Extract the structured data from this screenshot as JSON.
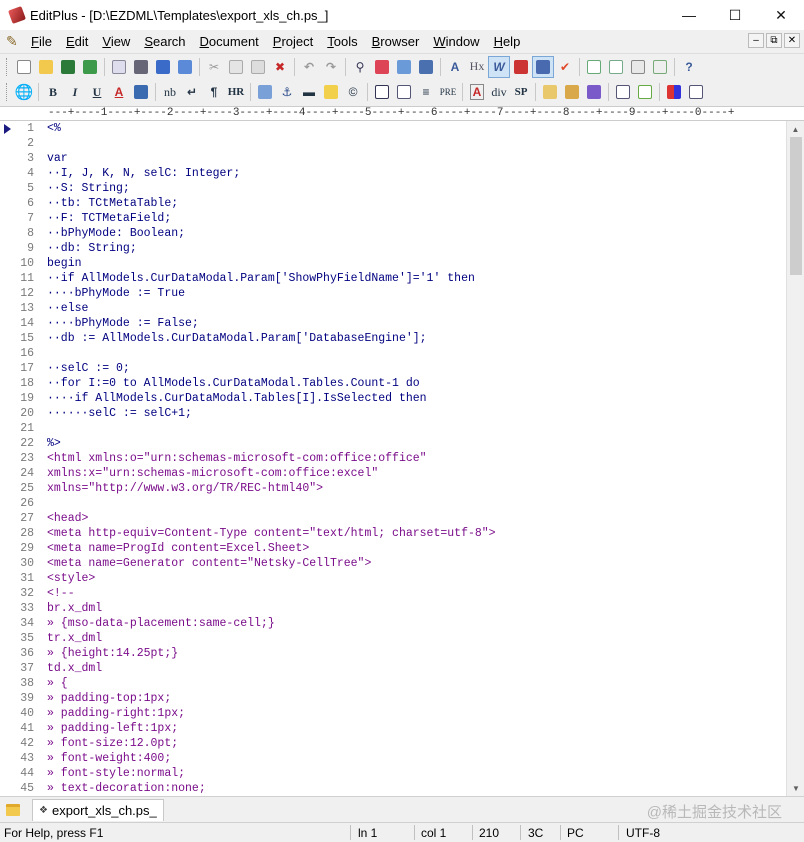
{
  "window": {
    "title": "EditPlus - [D:\\EZDML\\Templates\\export_xls_ch.ps_]"
  },
  "menu": [
    {
      "key": "F",
      "rest": "ile"
    },
    {
      "key": "E",
      "rest": "dit"
    },
    {
      "key": "V",
      "rest": "iew"
    },
    {
      "key": "S",
      "rest": "earch"
    },
    {
      "key": "D",
      "rest": "ocument"
    },
    {
      "key": "P",
      "rest": "roject"
    },
    {
      "key": "T",
      "rest": "ools"
    },
    {
      "key": "B",
      "rest": "rowser"
    },
    {
      "key": "W",
      "rest": "indow"
    },
    {
      "key": "H",
      "rest": "elp"
    }
  ],
  "toolbar2": {
    "bold": "B",
    "italic": "I",
    "underline": "U",
    "font_color": "A",
    "nb": "nb",
    "para": "¶",
    "hr": "HR",
    "pre": "PRE",
    "div": "div",
    "sp": "SP",
    "heading": "Hx"
  },
  "ruler": "---+----1----+----2----+----3----+----4----+----5----+----6----+----7----+----8----+----9----+----0----+",
  "lines": [
    {
      "n": "1",
      "t": "<%"
    },
    {
      "n": "2",
      "t": ""
    },
    {
      "n": "3",
      "t": "var"
    },
    {
      "n": "4",
      "t": "··I, J, K, N, selC: Integer;"
    },
    {
      "n": "5",
      "t": "··S: String;"
    },
    {
      "n": "6",
      "t": "··tb: TCtMetaTable;"
    },
    {
      "n": "7",
      "t": "··F: TCTMetaField;"
    },
    {
      "n": "8",
      "t": "··bPhyMode: Boolean;"
    },
    {
      "n": "9",
      "t": "··db: String;"
    },
    {
      "n": "10",
      "t": "begin"
    },
    {
      "n": "11",
      "t": "··if AllModels.CurDataModal.Param['ShowPhyFieldName']='1' then"
    },
    {
      "n": "12",
      "t": "····bPhyMode := True"
    },
    {
      "n": "13",
      "t": "··else"
    },
    {
      "n": "14",
      "t": "····bPhyMode := False;"
    },
    {
      "n": "15",
      "t": "··db := AllModels.CurDataModal.Param['DatabaseEngine'];"
    },
    {
      "n": "16",
      "t": ""
    },
    {
      "n": "17",
      "t": "··selC := 0;"
    },
    {
      "n": "18",
      "t": "··for I:=0 to AllModels.CurDataModal.Tables.Count-1 do"
    },
    {
      "n": "19",
      "t": "····if AllModels.CurDataModal.Tables[I].IsSelected then"
    },
    {
      "n": "20",
      "t": "······selC := selC+1;"
    },
    {
      "n": "21",
      "t": ""
    },
    {
      "n": "22",
      "t": "%>"
    },
    {
      "n": "23",
      "t": "<html xmlns:o=\"urn:schemas-microsoft-com:office:office\""
    },
    {
      "n": "24",
      "t": "xmlns:x=\"urn:schemas-microsoft-com:office:excel\""
    },
    {
      "n": "25",
      "t": "xmlns=\"http://www.w3.org/TR/REC-html40\">"
    },
    {
      "n": "26",
      "t": ""
    },
    {
      "n": "27",
      "t": "<head>"
    },
    {
      "n": "28",
      "t": "<meta http-equiv=Content-Type content=\"text/html; charset=utf-8\">"
    },
    {
      "n": "29",
      "t": "<meta name=ProgId content=Excel.Sheet>"
    },
    {
      "n": "30",
      "t": "<meta name=Generator content=\"Netsky-CellTree\">"
    },
    {
      "n": "31",
      "t": "<style>"
    },
    {
      "n": "32",
      "t": "<!--"
    },
    {
      "n": "33",
      "t": "br.x_dml"
    },
    {
      "n": "34",
      "t": "» {mso-data-placement:same-cell;}"
    },
    {
      "n": "35",
      "t": "tr.x_dml"
    },
    {
      "n": "36",
      "t": "» {height:14.25pt;}"
    },
    {
      "n": "37",
      "t": "td.x_dml"
    },
    {
      "n": "38",
      "t": "» {"
    },
    {
      "n": "39",
      "t": "» padding-top:1px;"
    },
    {
      "n": "40",
      "t": "» padding-right:1px;"
    },
    {
      "n": "41",
      "t": "» padding-left:1px;"
    },
    {
      "n": "42",
      "t": "» font-size:12.0pt;"
    },
    {
      "n": "43",
      "t": "» font-weight:400;"
    },
    {
      "n": "44",
      "t": "» font-style:normal;"
    },
    {
      "n": "45",
      "t": "» text-decoration:none;"
    }
  ],
  "tab": {
    "label": "export_xls_ch.ps_"
  },
  "watermark": "@稀土掘金技术社区",
  "status": {
    "help": "For Help, press F1",
    "line": "ln 1",
    "col": "col 1",
    "total": "210",
    "hex": "3C",
    "format": "PC",
    "encoding": "UTF-8"
  }
}
